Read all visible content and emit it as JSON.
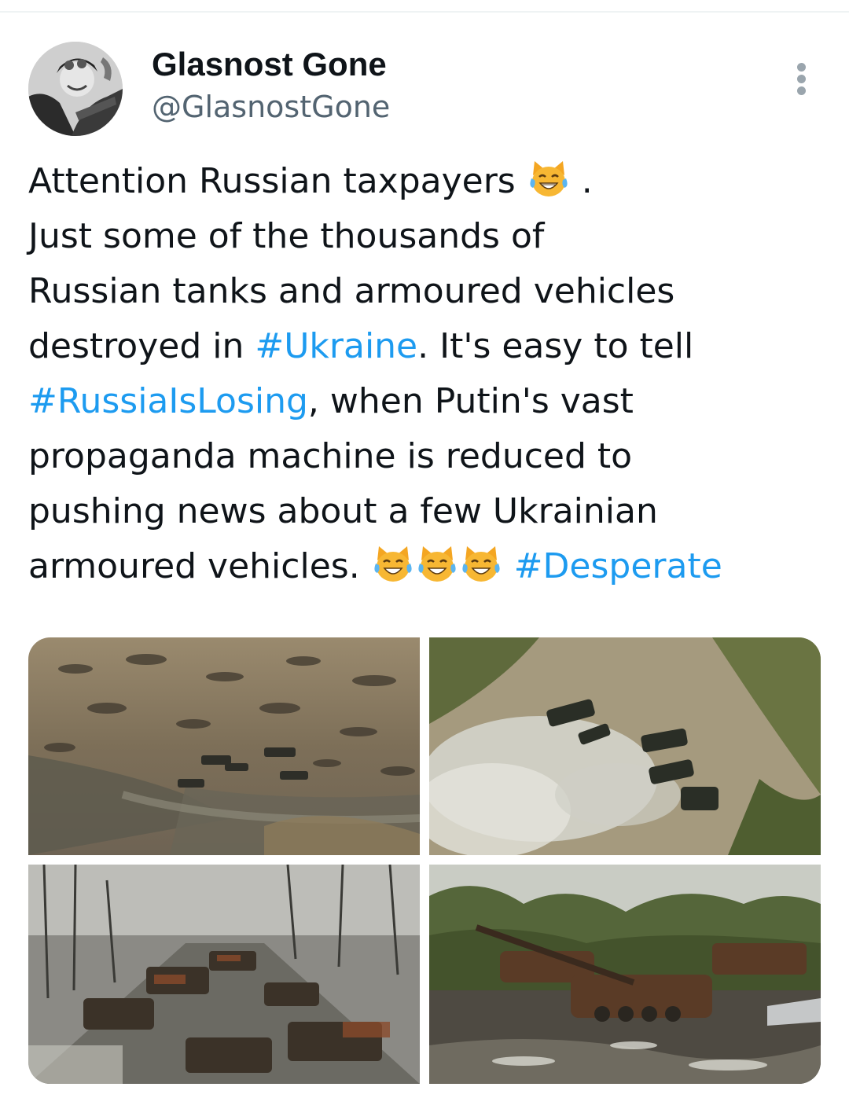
{
  "author": {
    "display_name": "Glasnost Gone",
    "handle": "@GlasnostGone"
  },
  "tweet": {
    "line1": "Attention Russian taxpayers",
    "line1_end": ".",
    "line2": "Just some of the thousands of",
    "line3": "Russian tanks and armoured vehicles",
    "line4_pre": "destroyed in ",
    "hashtag_ukraine": "#Ukraine",
    "line4_post": ". It's easy to tell",
    "hashtag_russiaislosing": "#RussiaIsLosing",
    "line5_post": ", when Putin's vast",
    "line6": "propaganda machine is reduced to",
    "line7": "pushing news about a few Ukrainian",
    "line8_pre": "armoured vehicles. ",
    "hashtag_desperate": "#Desperate"
  },
  "icons": {
    "more": "more-vertical-icon",
    "emoji": "cat-face-with-tears-of-joy-emoji"
  },
  "colors": {
    "hashtag": "#1d9bf0",
    "handle": "#536471",
    "text": "#0f1419"
  }
}
